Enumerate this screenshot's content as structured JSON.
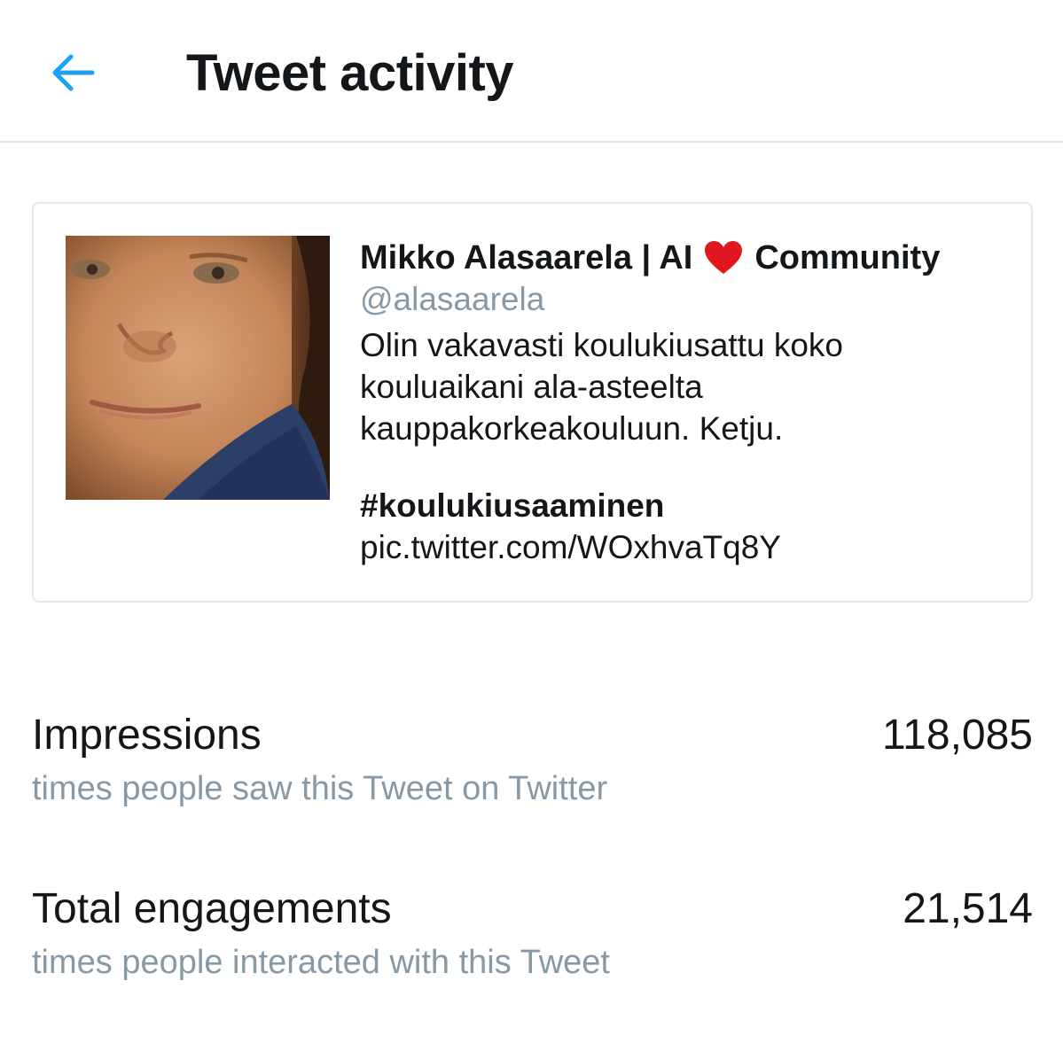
{
  "header": {
    "title": "Tweet activity",
    "back_icon": "arrow-left-icon",
    "accent_color": "#1da1f2"
  },
  "tweet": {
    "author_name_part1": "Mikko Alasaarela | AI",
    "author_name_part2": "Community",
    "heart_icon": "red-heart-emoji",
    "handle": "@alasaarela",
    "body_line1": "Olin vakavasti koulukiusattu koko",
    "body_line2": "kouluaikani ala-asteelta",
    "body_line3": "kauppakorkeakouluun. Ketju.",
    "hashtag": "#koulukiusaaminen",
    "pic_link": "pic.twitter.com/WOxhvaTq8Y"
  },
  "metrics": [
    {
      "label": "Impressions",
      "value": "118,085",
      "description": "times people saw this Tweet on Twitter"
    },
    {
      "label": "Total engagements",
      "value": "21,514",
      "description": "times people interacted with this Tweet"
    }
  ],
  "colors": {
    "text_primary": "#14171a",
    "text_secondary": "#8899a6",
    "divider": "#dfe6ea",
    "heart": "#e0171f"
  }
}
